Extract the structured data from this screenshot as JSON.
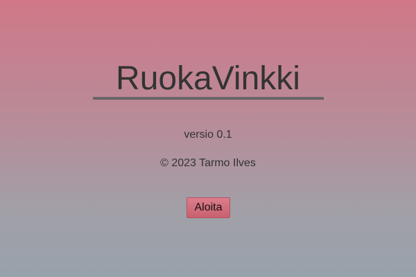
{
  "app": {
    "title": "RuokaVinkki",
    "version_text": "versio 0.1",
    "copyright_text": "© 2023 Tarmo Ilves"
  },
  "actions": {
    "start_label": "Aloita"
  },
  "colors": {
    "background_top": "#d07888",
    "background_bottom": "#98a2ab",
    "title_underline": "#676569",
    "button_fill": "#d06f7d",
    "text": "#333333"
  }
}
